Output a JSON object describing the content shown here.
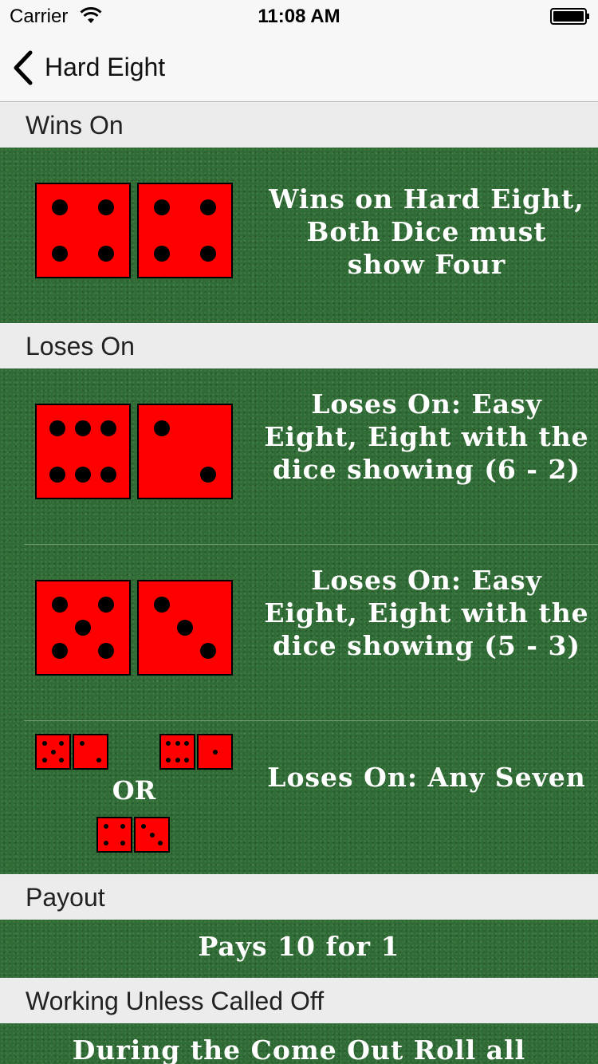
{
  "status_bar": {
    "carrier": "Carrier",
    "time": "11:08 AM"
  },
  "nav": {
    "back_icon": "chevron-left-icon",
    "title": "Hard Eight"
  },
  "sections": {
    "wins_on": {
      "header": "Wins On",
      "rows": [
        {
          "text": "Wins on Hard Eight, Both Dice must show Four",
          "dice": [
            4,
            4
          ]
        }
      ]
    },
    "loses_on": {
      "header": "Loses On",
      "rows": [
        {
          "text": "Loses On: Easy Eight, Eight with the dice showing (6 - 2)",
          "dice": [
            6,
            2
          ]
        },
        {
          "text": "Loses On: Easy Eight, Eight with the dice showing (5 - 3)",
          "dice": [
            5,
            3
          ]
        },
        {
          "text": "Loses On: Any Seven",
          "or_label": "OR",
          "dice_pairs": [
            [
              5,
              2
            ],
            [
              6,
              1
            ],
            [
              4,
              3
            ]
          ]
        }
      ]
    },
    "payout": {
      "header": "Payout",
      "text": "Pays 10 for 1"
    },
    "working": {
      "header": "Working Unless Called Off",
      "text": "During the Come Out Roll all"
    }
  },
  "colors": {
    "felt": "#2f6b34",
    "die": "#ff0000",
    "header_bg": "#ececec"
  }
}
